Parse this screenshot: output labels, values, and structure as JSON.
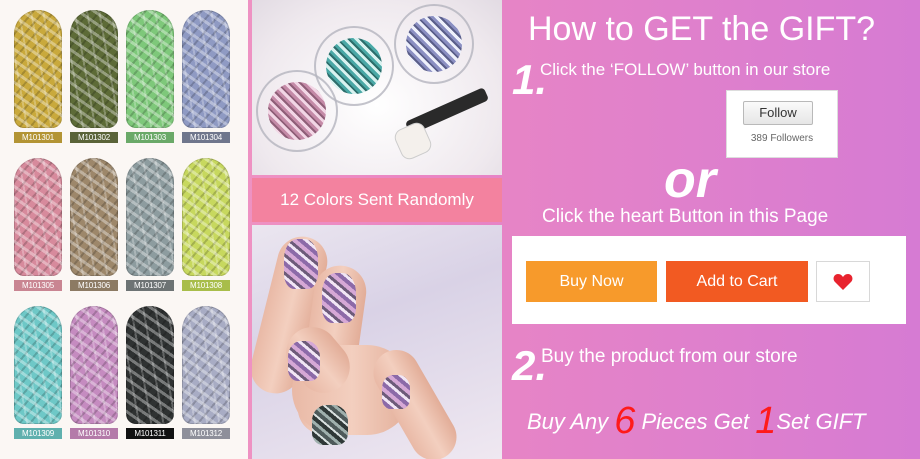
{
  "swatches": [
    {
      "code": "M101301",
      "color": "#c9a93c",
      "label_bg": "#b39434"
    },
    {
      "code": "M101302",
      "color": "#5d6b37",
      "label_bg": "#5a6338"
    },
    {
      "code": "M101303",
      "color": "#7ec87a",
      "label_bg": "#6aa968"
    },
    {
      "code": "M101304",
      "color": "#8f9ac3",
      "label_bg": "#6f768c"
    },
    {
      "code": "M101305",
      "color": "#d78a9c",
      "label_bg": "#c98592"
    },
    {
      "code": "M101306",
      "color": "#9d876a",
      "label_bg": "#8c7a63"
    },
    {
      "code": "M101307",
      "color": "#8d9c9f",
      "label_bg": "#6d7374"
    },
    {
      "code": "M101308",
      "color": "#c7d85e",
      "label_bg": "#a8bd4a"
    },
    {
      "code": "M101309",
      "color": "#6ec8c7",
      "label_bg": "#5fb0ae"
    },
    {
      "code": "M101310",
      "color": "#c58bc0",
      "label_bg": "#b47aa9"
    },
    {
      "code": "M101311",
      "color": "#2f3232",
      "label_bg": "#111111"
    },
    {
      "code": "M101312",
      "color": "#a8acc4",
      "label_bg": "#8e8f9a"
    }
  ],
  "caption": "12 Colors Sent Randomly",
  "title": "How to GET the GIFT?",
  "step1": {
    "number": "1.",
    "text": "Click the ‘FOLLOW’ button in our store"
  },
  "follow_card": {
    "button": "Follow",
    "followers": "389 Followers"
  },
  "or": "or",
  "heart_instruction": "Click the heart Button in this Page",
  "buttons": {
    "buy_now": "Buy Now",
    "add_to_cart": "Add to Cart",
    "heart_icon": "heart-icon"
  },
  "step2": {
    "number": "2.",
    "text": "Buy the product from our store"
  },
  "promo": {
    "part1": "Buy Any ",
    "num1": "6",
    "part2": " Pieces Get ",
    "num2": "1",
    "part3": "Set GIFT"
  },
  "colors": {
    "accent_red": "#ff1a1a",
    "buy_now": "#f79a2b",
    "add_to_cart": "#f25a22",
    "caption_bg": "#f3829f"
  }
}
